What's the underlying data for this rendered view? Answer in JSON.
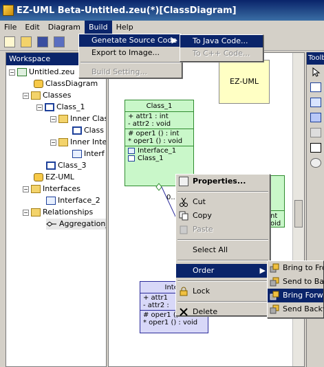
{
  "window": {
    "title": "EZ-UML Beta-Untitled.zeu(*)[ClassDiagram]"
  },
  "menubar": {
    "items": [
      "File",
      "Edit",
      "Diagram",
      "Build",
      "Help"
    ]
  },
  "build_menu": {
    "items": [
      "Genetate Source Code",
      "Export to Image...",
      "Build Setting..."
    ]
  },
  "source_submenu": {
    "items": [
      "To Java Code...",
      "To C++ Code..."
    ]
  },
  "workspace": {
    "title": "Workspace",
    "tree": [
      {
        "label": "Untitled.zeu"
      },
      {
        "label": "ClassDiagram"
      },
      {
        "label": "Classes"
      },
      {
        "label": "Class_1"
      },
      {
        "label": "Inner Clas"
      },
      {
        "label": "Class"
      },
      {
        "label": "Inner Inte"
      },
      {
        "label": "Interf"
      },
      {
        "label": "Class_3"
      },
      {
        "label": "EZ-UML"
      },
      {
        "label": "Interfaces"
      },
      {
        "label": "Interface_2"
      },
      {
        "label": "Relationships"
      },
      {
        "label": "Aggregation_"
      }
    ]
  },
  "toolbox": {
    "title": "Toolb"
  },
  "canvas": {
    "note": "EZ-UML",
    "class1": {
      "name": "Class_1",
      "attrs": [
        "+   attr1  : int",
        "-   attr2  : void"
      ],
      "ops": [
        "#   oper1 () : int",
        "*   oper1 () : void"
      ],
      "inners": [
        "Interface_1",
        "Class_1"
      ]
    },
    "iface": {
      "name": "Interf",
      "attrs": [
        "+   attr1",
        "-   attr2  :"
      ],
      "ops": [
        "#   oper1 () : int",
        "*   oper1 () : void"
      ]
    },
    "right_class": {
      "rows": [
        "nt",
        "oid"
      ]
    },
    "link_label": "0.."
  },
  "context_menu": {
    "items": [
      "Properties...",
      "Cut",
      "Copy",
      "Paste",
      "Select All",
      "Order",
      "Lock",
      "Delete"
    ]
  },
  "order_submenu": {
    "items": [
      "Bring to Front",
      "Send to Back",
      "Bring Forward",
      "Send Backward"
    ]
  }
}
